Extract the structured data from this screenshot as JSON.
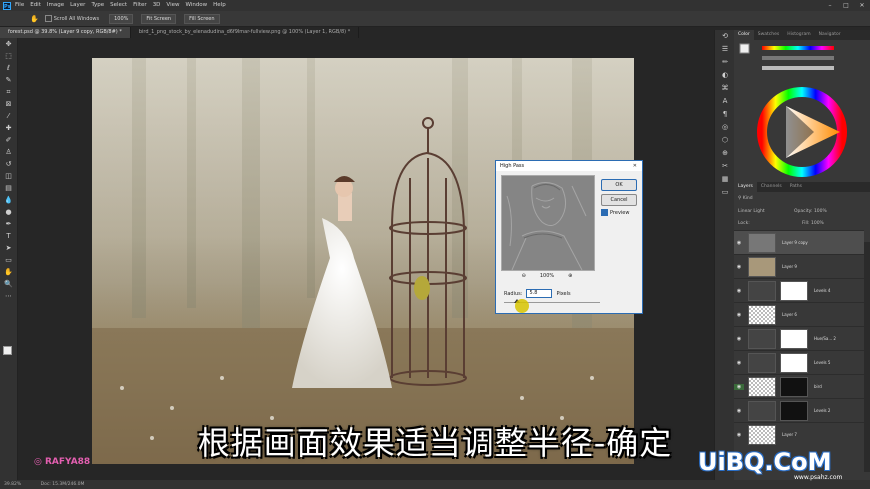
{
  "menubar": {
    "logo": "Ps",
    "items": [
      "File",
      "Edit",
      "Image",
      "Layer",
      "Type",
      "Select",
      "Filter",
      "3D",
      "View",
      "Window",
      "Help"
    ]
  },
  "options": {
    "scroll_all": "Scroll All Windows",
    "zoom": "100%",
    "fit_screen": "Fit Screen",
    "fill_screen": "Fill Screen"
  },
  "tabs": [
    {
      "label": "forest.psd @ 39.8% (Layer 9 copy, RGB/8#) *",
      "active": true
    },
    {
      "label": "bird_1_png_stock_by_elenadudina_d6f9lmar-fullview.png @ 100% (Layer 1, RGB/8) *",
      "active": false
    }
  ],
  "statusbar": {
    "zoom": "39.82%",
    "doc": "Doc: 15.3M/246.0M"
  },
  "right_panel": {
    "color_tabs": [
      "Color",
      "Swatches",
      "Histogram",
      "Navigator"
    ],
    "layer_tabs": [
      "Layers",
      "Channels",
      "Paths"
    ],
    "kind": "Kind",
    "blend_mode": "Linear Light",
    "opacity_label": "Opacity:",
    "opacity": "100%",
    "lock_label": "Lock:",
    "fill_label": "Fill:",
    "fill": "100%",
    "layers": [
      {
        "name": "Layer 9 copy",
        "type": "pixel",
        "selected": true
      },
      {
        "name": "Layer 9",
        "type": "photo",
        "selected": false
      },
      {
        "name": "Levels 4",
        "type": "adjust",
        "selected": false
      },
      {
        "name": "Layer 6",
        "type": "pixel",
        "selected": false
      },
      {
        "name": "Hue/Sa... 2",
        "type": "adjust",
        "selected": false
      },
      {
        "name": "Levels 5",
        "type": "adjust",
        "selected": false
      },
      {
        "name": "bird",
        "type": "group",
        "selected": false
      },
      {
        "name": "Levels 2",
        "type": "adjust",
        "selected": false
      },
      {
        "name": "Layer 7",
        "type": "pixel",
        "selected": false
      }
    ]
  },
  "dialog": {
    "title": "High Pass",
    "ok": "OK",
    "cancel": "Cancel",
    "preview": "Preview",
    "zoom": "100%",
    "radius_label": "Radius:",
    "radius_value": "5.8",
    "radius_unit": "Pixels"
  },
  "overlay": {
    "subtitle": "根据画面效果适当调整半径-确定",
    "handle": "RAFYA88",
    "watermark": "UiBQ.CoM",
    "watermark_url": "www.psahz.com"
  },
  "colors": {
    "accent": "#2b6cb3",
    "ps_blue": "#31a8ff",
    "cursor": "#d7c400"
  }
}
